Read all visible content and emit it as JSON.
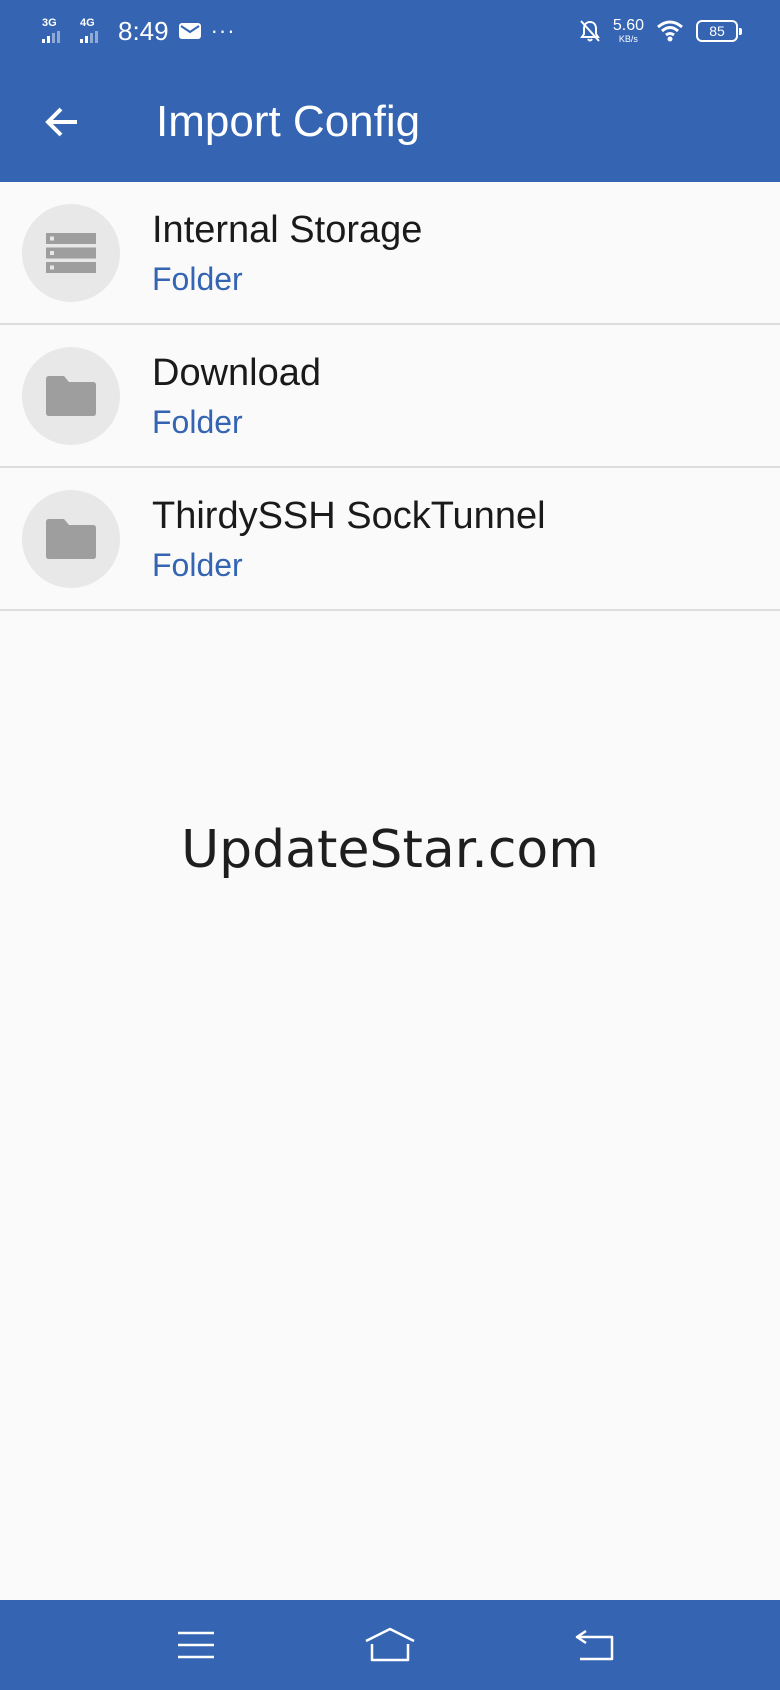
{
  "status_bar": {
    "network_1": "3G",
    "network_2": "4G",
    "time": "8:49",
    "more": "···",
    "speed_value": "5.60",
    "speed_unit": "KB/s",
    "battery": "85",
    "icons": [
      "signal-icon",
      "mail-icon",
      "mute-bell-icon",
      "wifi-icon",
      "battery-icon"
    ]
  },
  "app_bar": {
    "title": "Import Config",
    "back_icon": "arrow-back-icon"
  },
  "files": [
    {
      "name": "Internal Storage",
      "type": "Folder",
      "icon": "storage-icon"
    },
    {
      "name": "Download",
      "type": "Folder",
      "icon": "folder-icon"
    },
    {
      "name": "ThirdySSH SockTunnel",
      "type": "Folder",
      "icon": "folder-icon"
    }
  ],
  "watermark": "UpdateStar.com",
  "nav_bar": {
    "icons": [
      "menu-icon",
      "home-icon",
      "back-icon"
    ]
  },
  "colors": {
    "primary": "#3464b2",
    "background": "#fafafa",
    "divider": "#dddddd",
    "icon_gray": "#9e9e9e",
    "avatar_bg": "#e8e8e8"
  }
}
